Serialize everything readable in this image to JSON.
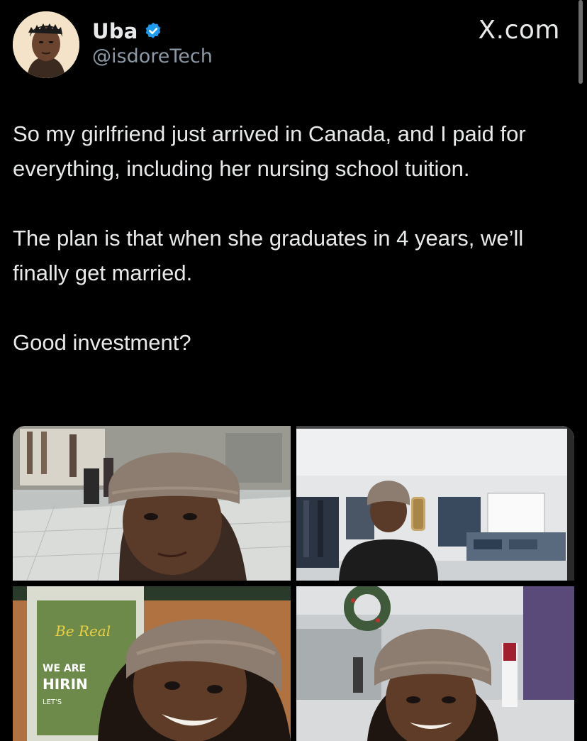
{
  "author": {
    "display_name": "Uba",
    "handle": "@isdoreTech",
    "verified": true
  },
  "brand": "X.com",
  "tweet": {
    "paragraphs": [
      "So my girlfriend just arrived in Canada, and I paid for everything, including her nursing school tuition.",
      "The plan is that when she graduates in 4 years, we’ll finally get married.",
      "Good investment?"
    ]
  },
  "media": {
    "photos": [
      {
        "subject": "selfie-in-mall-with-beanie"
      },
      {
        "subject": "mirror-selfie-in-clothing-store"
      },
      {
        "subject": "selfie-smiling-near-hiring-poster",
        "poster_text": [
          "Be Real",
          "WE ARE",
          "HIRIN",
          "LET'S"
        ]
      },
      {
        "subject": "selfie-in-mall-with-wreath"
      }
    ]
  },
  "colors": {
    "background": "#000000",
    "text": "#e7e9ea",
    "secondary_text": "#8b98a5",
    "verified_blue": "#1d9bf0"
  },
  "icons": {
    "verified": "verified-badge-icon"
  }
}
